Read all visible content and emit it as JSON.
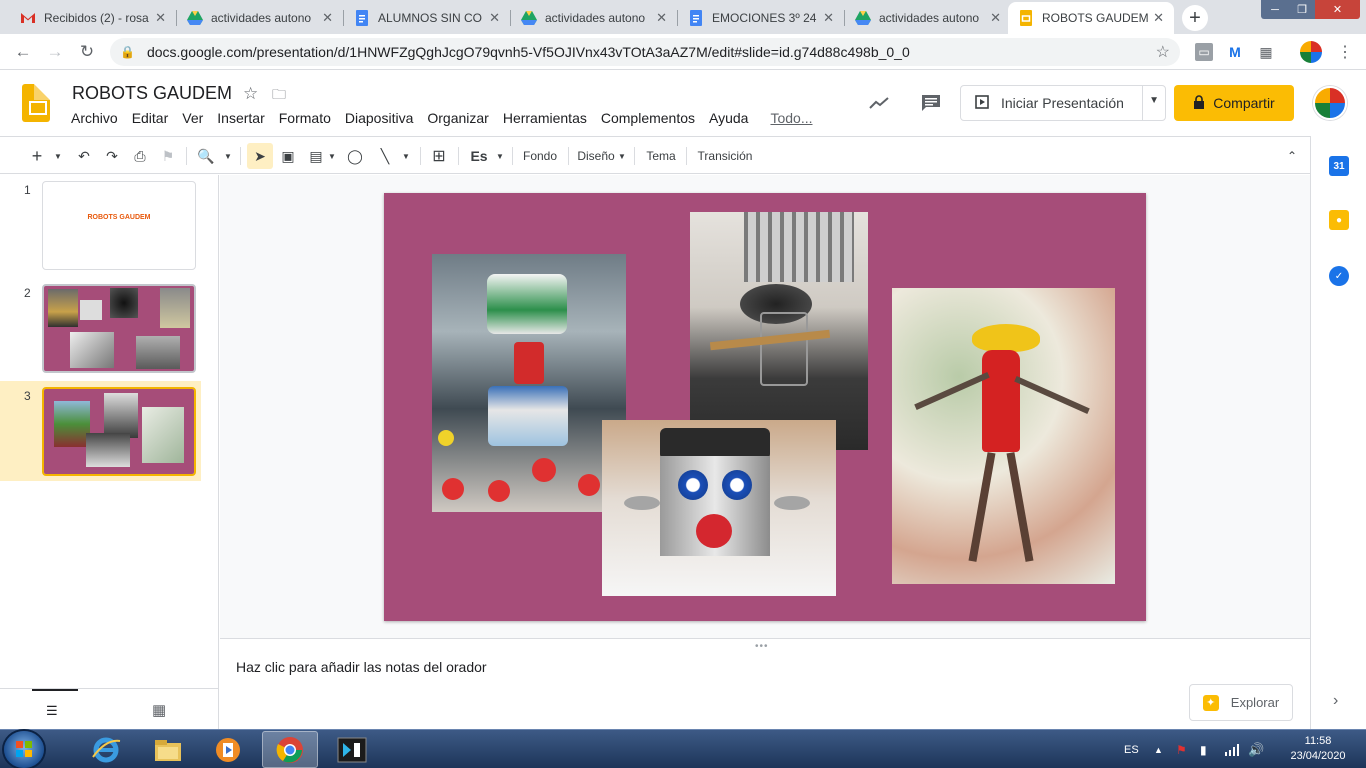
{
  "browser": {
    "tabs": [
      {
        "label": "Recibidos (2) - rosa",
        "icon": "gmail-icon"
      },
      {
        "label": "actividades autono",
        "icon": "drive-icon"
      },
      {
        "label": "ALUMNOS SIN CO",
        "icon": "docs-icon"
      },
      {
        "label": "actividades autono",
        "icon": "drive-icon"
      },
      {
        "label": "EMOCIONES 3º 24",
        "icon": "docs-icon"
      },
      {
        "label": "actividades autono",
        "icon": "drive-icon"
      },
      {
        "label": "ROBOTS GAUDEM",
        "icon": "slides-icon"
      }
    ],
    "close_glyph": "✕",
    "new_tab_glyph": "+",
    "url": "docs.google.com/presentation/d/1HNWFZgQghJcgO79qvnh5-Vf5OJIVnx43vTOtA3aAZ7M/edit#slide=id.g74d88c498b_0_0"
  },
  "app": {
    "title": "ROBOTS GAUDEM",
    "menu": [
      "Archivo",
      "Editar",
      "Ver",
      "Insertar",
      "Formato",
      "Diapositiva",
      "Organizar",
      "Herramientas",
      "Complementos",
      "Ayuda",
      "Todo..."
    ],
    "present_label": "Iniciar Presentación",
    "share_label": "Compartir"
  },
  "toolbar": {
    "input_tools": "Es",
    "fondo": "Fondo",
    "diseno": "Diseño",
    "tema": "Tema",
    "transicion": "Transición"
  },
  "slides": [
    {
      "number": "1",
      "title": "ROBOTS GAUDEM"
    },
    {
      "number": "2"
    },
    {
      "number": "3"
    }
  ],
  "current_slide": {
    "background_color": "#a64d79",
    "photos": [
      "robot-detergent-photo",
      "kitchen-utensil-photo",
      "ketchup-robot-photo",
      "tin-can-robot-photo"
    ]
  },
  "notes": {
    "placeholder": "Haz clic para añadir las notas del orador",
    "explore_label": "Explorar"
  },
  "side_panel": {
    "calendar_label": "31"
  },
  "taskbar": {
    "language": "ES",
    "time": "11:58",
    "date": "23/04/2020"
  },
  "colors": {
    "accent": "#fbbc04",
    "slide_bg": "#a64d79",
    "selected_row": "#feefc3"
  }
}
